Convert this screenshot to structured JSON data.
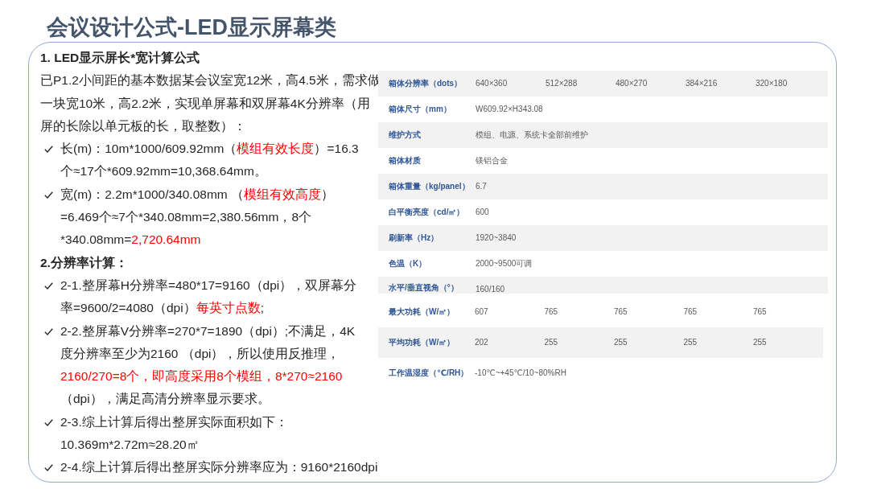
{
  "title": "会议设计公式-LED显示屏幕类",
  "content": [
    {
      "kind": "heading",
      "text": "1. LED显示屏长*宽计算公式"
    },
    {
      "kind": "paragraph",
      "lines": [
        [
          {
            "text": "已P1.2小间距的基本数据某会议室宽12米，高4.5米，需求做",
            "highlight": false
          }
        ],
        [
          {
            "text": "一块宽10米，高2.2米，实现单屏幕和双屏幕4K分辨率（用",
            "highlight": false
          }
        ],
        [
          {
            "text": "屏的长除以单元板的长，取整数）：",
            "highlight": false
          }
        ]
      ]
    },
    {
      "kind": "bullet",
      "lines": [
        [
          {
            "text": "长(m)：10m*1000/609.92mm（",
            "highlight": false
          },
          {
            "text": "模组有效长度",
            "highlight": true
          },
          {
            "text": "）=16.3",
            "highlight": false
          }
        ],
        [
          {
            "text": "个≈17个*609.92mm=10,368.64mm。",
            "highlight": false
          }
        ]
      ]
    },
    {
      "kind": "bullet",
      "lines": [
        [
          {
            "text": "宽(m)：2.2m*1000/340.08mm （",
            "highlight": false
          },
          {
            "text": "模组有效高度",
            "highlight": true
          },
          {
            "text": "）",
            "highlight": false
          }
        ],
        [
          {
            "text": "=6.469个≈7个*340.08mm=2,380.56mm，8个",
            "highlight": false
          }
        ],
        [
          {
            "text": "*340.08mm=",
            "highlight": false
          },
          {
            "text": "2,720.64mm",
            "highlight": true
          }
        ]
      ]
    },
    {
      "kind": "heading",
      "text": "2.分辨率计算："
    },
    {
      "kind": "bullet",
      "lines": [
        [
          {
            "text": "2-1.整屏幕H分辨率=480*17=9160（dpi），双屏幕分",
            "highlight": false
          }
        ],
        [
          {
            "text": "率=9600/2=4080（dpi）",
            "highlight": false
          },
          {
            "text": "每英寸点数",
            "highlight": true
          },
          {
            "text": ";",
            "highlight": false
          }
        ]
      ]
    },
    {
      "kind": "bullet",
      "lines": [
        [
          {
            "text": "2-2.整屏幕V分辨率=270*7=1890（dpi）;不满足，4K",
            "highlight": false
          }
        ],
        [
          {
            "text": "度分辨率至少为2160 （dpi），所以使用反推理，",
            "highlight": false
          }
        ],
        [
          {
            "text": "2160/270=8个，即高度采用8个模组，8*270≈2160",
            "highlight": true
          }
        ],
        [
          {
            "text": "（dpi），满足高清分辨率显示要求。",
            "highlight": false
          }
        ]
      ]
    },
    {
      "kind": "bullet",
      "lines": [
        [
          {
            "text": "2-3.综上计算后得出整屏实际面积如下：",
            "highlight": false
          }
        ],
        [
          {
            "text": "10.369m*2.72m≈28.20㎡",
            "highlight": false
          }
        ]
      ]
    },
    {
      "kind": "bullet",
      "lines": [
        [
          {
            "text": "2-4.综上计算后得出整屏实际分辨率应为：9160*2160dpi",
            "highlight": false
          }
        ]
      ]
    }
  ],
  "spec_table": {
    "sections": [
      {
        "rows": [
          {
            "label": "箱体分辨率（dots）",
            "values": [
              "640×360",
              "512×288",
              "480×270",
              "384×216",
              "320×180"
            ],
            "shaded": true
          },
          {
            "label": "箱体尺寸（mm）",
            "values": [
              "W609.92×H343.08"
            ],
            "shaded": false
          },
          {
            "label": "维护方式",
            "values": [
              "模组、电源、系统卡全部前维护"
            ],
            "shaded": true
          },
          {
            "label": "箱体材质",
            "values": [
              "镁铝合金"
            ],
            "shaded": false
          },
          {
            "label": "箱体重量（kg/panel）",
            "values": [
              "6.7"
            ],
            "shaded": true
          },
          {
            "label": "白平衡亮度（cd/㎡）",
            "values": [
              "600"
            ],
            "shaded": false
          },
          {
            "label": "刷新率（Hz）",
            "values": [
              "1920~3840"
            ],
            "shaded": true
          },
          {
            "label": "色温（K）",
            "values": [
              "2000~9500可调"
            ],
            "shaded": false
          },
          {
            "label": "水平/垂直视角（°）",
            "values": [
              "160/160"
            ],
            "shaded": true
          }
        ]
      },
      {
        "rows": [
          {
            "label": "最大功耗（W/㎡）",
            "values": [
              "607",
              "765",
              "765",
              "765",
              "765"
            ],
            "shaded": false
          },
          {
            "label": "平均功耗（W/㎡）",
            "values": [
              "202",
              "255",
              "255",
              "255",
              "255"
            ],
            "shaded": true
          },
          {
            "label": "工作温湿度（℃/RH）",
            "values": [
              "-10℃~+45℃/10~80%RH"
            ],
            "shaded": false
          }
        ]
      }
    ]
  }
}
